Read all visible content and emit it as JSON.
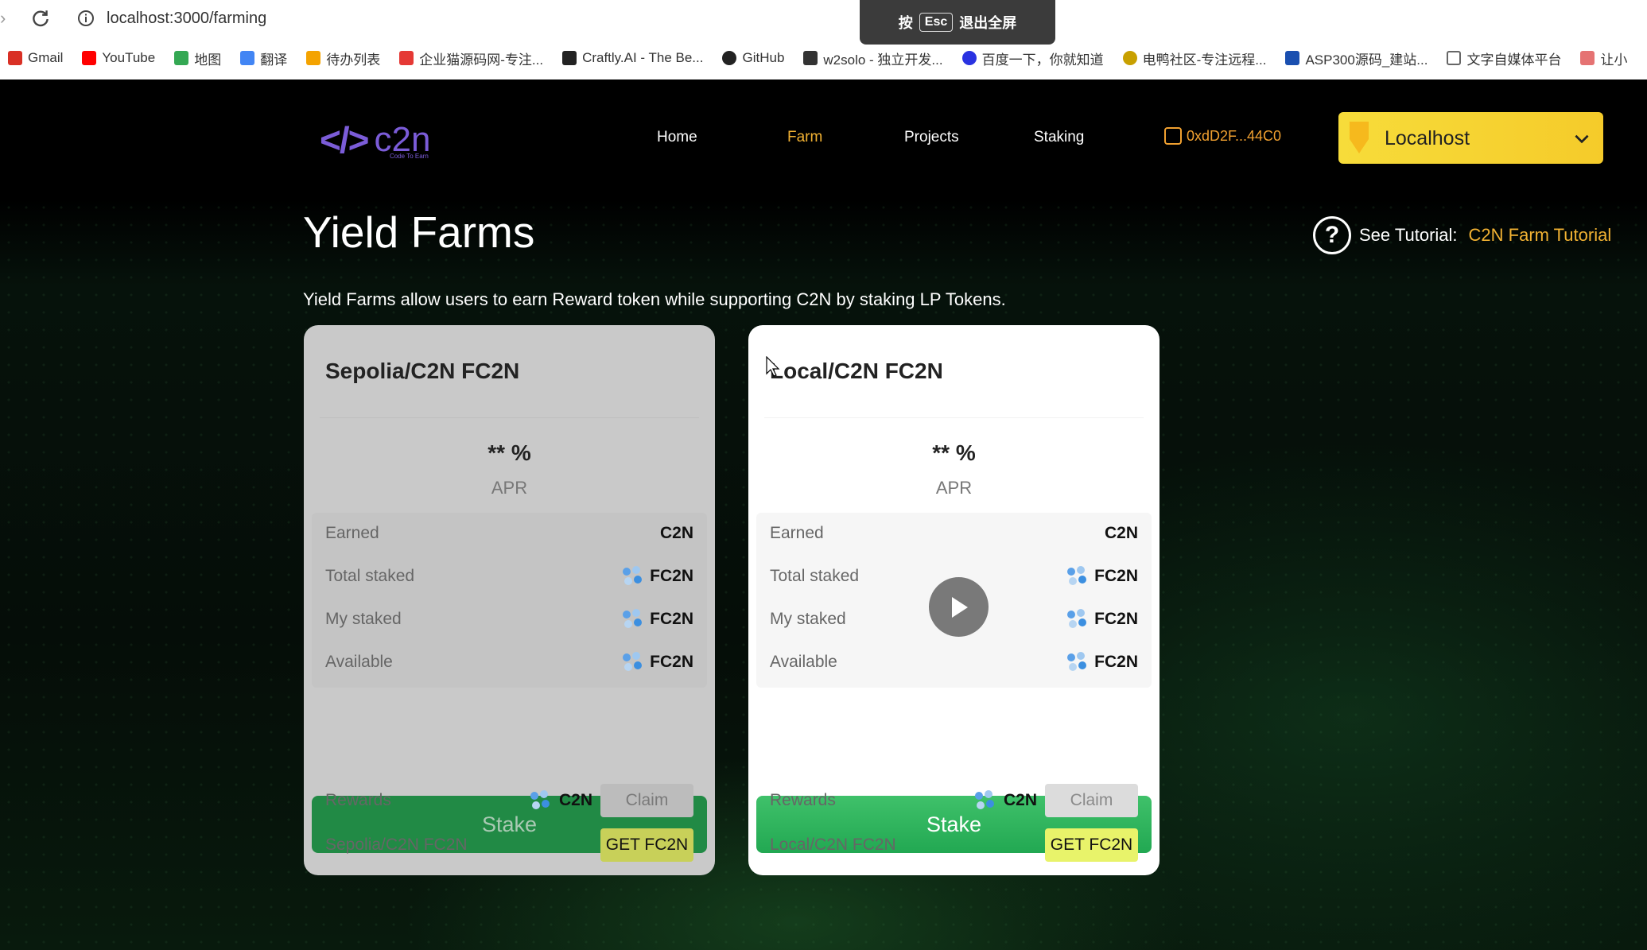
{
  "browser": {
    "url": "localhost:3000/farming",
    "fullscreen_toast": {
      "prefix": "按",
      "key": "Esc",
      "suffix": "退出全屏"
    },
    "bookmarks": [
      {
        "label": "Gmail",
        "color": "#d93025"
      },
      {
        "label": "YouTube",
        "color": "#ff0000"
      },
      {
        "label": "地图",
        "color": "#34a853"
      },
      {
        "label": "翻译",
        "color": "#4285f4"
      },
      {
        "label": "待办列表",
        "color": "#f4a300"
      },
      {
        "label": "企业猫源码网-专注...",
        "color": "#e53935"
      },
      {
        "label": "Craftly.AI - The Be...",
        "color": "#222222"
      },
      {
        "label": "GitHub",
        "color": "#222222"
      },
      {
        "label": "w2solo - 独立开发...",
        "color": "#333333"
      },
      {
        "label": "百度一下，你就知道",
        "color": "#2932e1"
      },
      {
        "label": "电鸭社区-专注远程...",
        "color": "#c8a000"
      },
      {
        "label": "ASP300源码_建站...",
        "color": "#1a4fb0"
      },
      {
        "label": "文字自媒体平台",
        "color": "#666666"
      },
      {
        "label": "让小",
        "color": "#e57373"
      }
    ]
  },
  "header": {
    "logo_text": "c2n",
    "logo_sub": "Code To Earn",
    "nav": [
      {
        "label": "Home",
        "active": false
      },
      {
        "label": "Farm",
        "active": true
      },
      {
        "label": "Projects",
        "active": false
      },
      {
        "label": "Staking",
        "active": false
      }
    ],
    "wallet": "0xdD2F...44C0",
    "network": "Localhost",
    "accent": "#f2b233"
  },
  "page": {
    "title": "Yield Farms",
    "tutorial_label": "See Tutorial:",
    "tutorial_link": "C2N Farm Tutorial",
    "subtitle": "Yield Farms allow users to earn Reward token while supporting C2N by staking LP Tokens."
  },
  "farms": [
    {
      "name": "Sepolia/C2N FC2N",
      "apr_value": "** %",
      "apr_label": "APR",
      "earned": {
        "label": "Earned",
        "value": "C2N"
      },
      "total_staked": {
        "label": "Total staked",
        "value": "FC2N"
      },
      "my_staked": {
        "label": "My staked",
        "value": "FC2N"
      },
      "available": {
        "label": "Available",
        "value": "FC2N"
      },
      "stake_label": "Stake",
      "rewards_label": "Rewards",
      "rewards_value": "C2N",
      "claim_label": "Claim",
      "pair_label": "Sepolia/C2N FC2N",
      "get_label": "GET FC2N"
    },
    {
      "name": "Local/C2N FC2N",
      "apr_value": "** %",
      "apr_label": "APR",
      "earned": {
        "label": "Earned",
        "value": "C2N"
      },
      "total_staked": {
        "label": "Total staked",
        "value": "FC2N"
      },
      "my_staked": {
        "label": "My staked",
        "value": "FC2N"
      },
      "available": {
        "label": "Available",
        "value": "FC2N"
      },
      "stake_label": "Stake",
      "rewards_label": "Rewards",
      "rewards_value": "C2N",
      "claim_label": "Claim",
      "pair_label": "Local/C2N FC2N",
      "get_label": "GET FC2N"
    }
  ]
}
